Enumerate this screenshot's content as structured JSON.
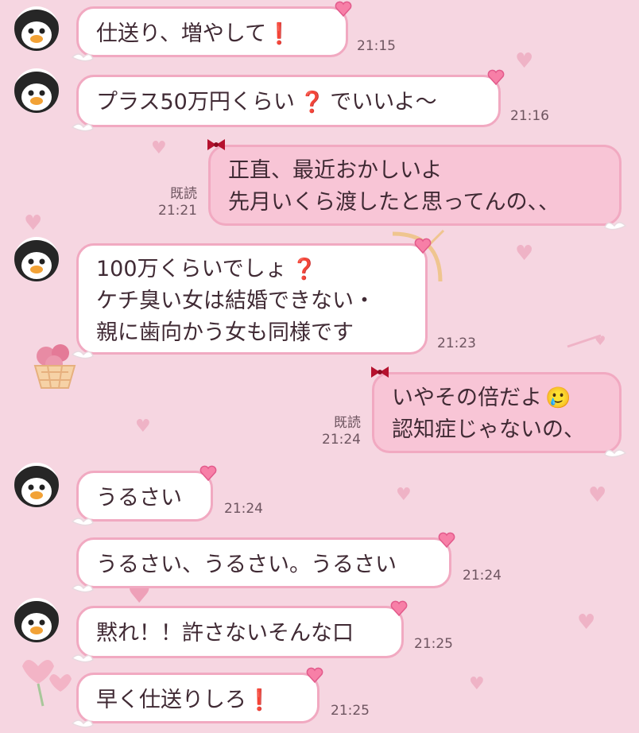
{
  "colors": {
    "background": "#f6d6e1",
    "bubble_border": "#f1a9c1",
    "sent_bubble": "#f8c5d6",
    "received_bubble": "#ffffff",
    "emphasis_red": "#d81c27"
  },
  "messages": [
    {
      "side": "left",
      "avatar": "penguin-icon",
      "lines": [
        "仕送り、増やして"
      ],
      "mark": "❗",
      "time": "21:15"
    },
    {
      "side": "left",
      "avatar": "penguin-icon",
      "lines": [
        "プラス50万円くらい",
        "でいいよ〜"
      ],
      "mark": "❓",
      "time": "21:16"
    },
    {
      "side": "right",
      "lines": [
        "正直、最近おかしいよ",
        "先月いくら渡したと思ってんの、、"
      ],
      "read": "既読",
      "time": "21:21"
    },
    {
      "side": "left",
      "avatar": "penguin-icon",
      "lines": [
        "100万くらいでしょ",
        "ケチ臭い女は結婚できない・",
        "親に歯向かう女も同様です"
      ],
      "mark": "❓",
      "time": "21:23"
    },
    {
      "side": "right",
      "lines": [
        "いやその倍だよ",
        "認知症じゃないの、"
      ],
      "emoji": "🥲",
      "read": "既読",
      "time": "21:24"
    },
    {
      "side": "left",
      "avatar": "penguin-icon",
      "lines": [
        "うるさい"
      ],
      "time": "21:24"
    },
    {
      "side": "left",
      "lines": [
        "うるさい、うるさい。うるさい"
      ],
      "time": "21:24"
    },
    {
      "side": "left",
      "avatar": "penguin-icon",
      "lines": [
        "黙れ！！許さないそんな口"
      ],
      "time": "21:25"
    },
    {
      "side": "left",
      "lines": [
        "早く仕送りしろ"
      ],
      "mark": "❗",
      "time": "21:25"
    }
  ]
}
